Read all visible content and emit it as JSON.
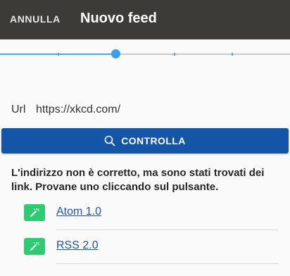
{
  "app_bar": {
    "cancel_label": "ANNULLA",
    "title": "Nuovo feed"
  },
  "stepper": {
    "current_step": 3,
    "total_steps": 6
  },
  "url_field": {
    "label": "Url",
    "value": "https://xkcd.com/"
  },
  "check_button": {
    "label": "CONTROLLA",
    "icon": "search-icon"
  },
  "message": "L'indirizzo non è corretto, ma sono stati trovati dei link. Provane uno cliccando sul pulsante.",
  "links": [
    {
      "label": "Atom 1.0",
      "icon": "magic-wand-icon"
    },
    {
      "label": "RSS 2.0",
      "icon": "magic-wand-icon"
    }
  ],
  "colors": {
    "app_bar": "#3d3b38",
    "accent": "#1455a8",
    "progress": "#4aa8ea",
    "link_icon_bg": "#2ecc71",
    "link_text": "#1a55b0"
  }
}
